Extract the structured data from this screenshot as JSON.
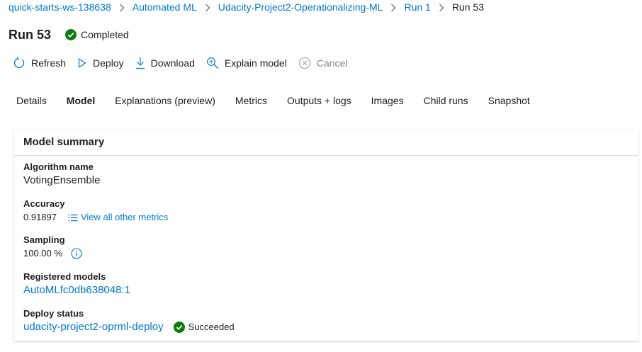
{
  "breadcrumb": {
    "items": [
      {
        "label": "quick-starts-ws-138638"
      },
      {
        "label": "Automated ML"
      },
      {
        "label": "Udacity-Project2-Operationalizing-ML"
      },
      {
        "label": "Run 1"
      },
      {
        "label": "Run 53"
      }
    ]
  },
  "header": {
    "title": "Run 53",
    "status": "Completed"
  },
  "toolbar": {
    "refresh": "Refresh",
    "deploy": "Deploy",
    "download": "Download",
    "explain": "Explain model",
    "cancel": "Cancel"
  },
  "tabs": [
    {
      "label": "Details"
    },
    {
      "label": "Model"
    },
    {
      "label": "Explanations (preview)"
    },
    {
      "label": "Metrics"
    },
    {
      "label": "Outputs + logs"
    },
    {
      "label": "Images"
    },
    {
      "label": "Child runs"
    },
    {
      "label": "Snapshot"
    }
  ],
  "active_tab": "Model",
  "model_summary": {
    "title": "Model summary",
    "algorithm_label": "Algorithm name",
    "algorithm_value": "VotingEnsemble",
    "accuracy_label": "Accuracy",
    "accuracy_value": "0.91897",
    "view_metrics": "View all other metrics",
    "sampling_label": "Sampling",
    "sampling_value": "100.00 %",
    "registered_label": "Registered models",
    "registered_value": "AutoMLfc0db638048:1",
    "deploy_label": "Deploy status",
    "deploy_value": "udacity-project2-oprml-deploy",
    "deploy_state": "Succeeded"
  },
  "colors": {
    "link": "#0078d4",
    "success": "#107c10",
    "text": "#201f1e",
    "disabled": "#8a8886"
  },
  "icons": [
    "chevron-right-icon",
    "check-circle-icon",
    "refresh-icon",
    "play-icon",
    "download-icon",
    "zoom-icon",
    "cancel-icon",
    "list-icon",
    "info-icon"
  ]
}
